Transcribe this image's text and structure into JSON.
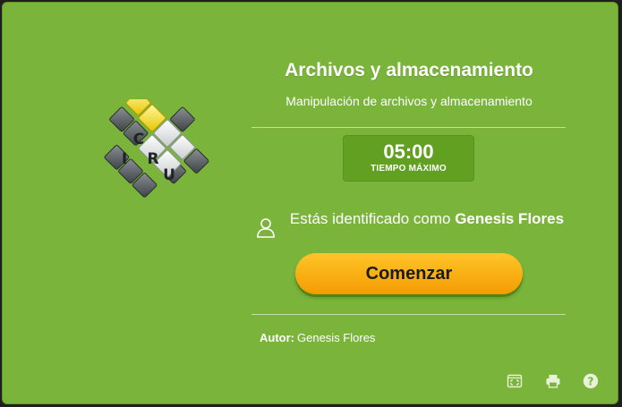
{
  "quiz": {
    "title": "Archivos y almacenamiento",
    "subtitle": "Manipulación de archivos y almacenamiento"
  },
  "timer": {
    "value": "05:00",
    "label": "TIEMPO MÁXIMO"
  },
  "identity": {
    "prefix": "Estás identificado como",
    "user_name": "Genesis Flores"
  },
  "start_button": {
    "label": "Comenzar"
  },
  "author": {
    "label": "Autor:",
    "name": "Genesis Flores"
  },
  "logo": {
    "letters": [
      "C",
      "I",
      "R",
      "U"
    ]
  },
  "footer": {
    "icons": [
      "fullscreen-icon",
      "print-icon",
      "help-icon"
    ]
  },
  "colors": {
    "background": "#7ab43a",
    "timer_box": "#62a021",
    "button_top": "#ffc52a",
    "button_bottom": "#f39c00"
  }
}
